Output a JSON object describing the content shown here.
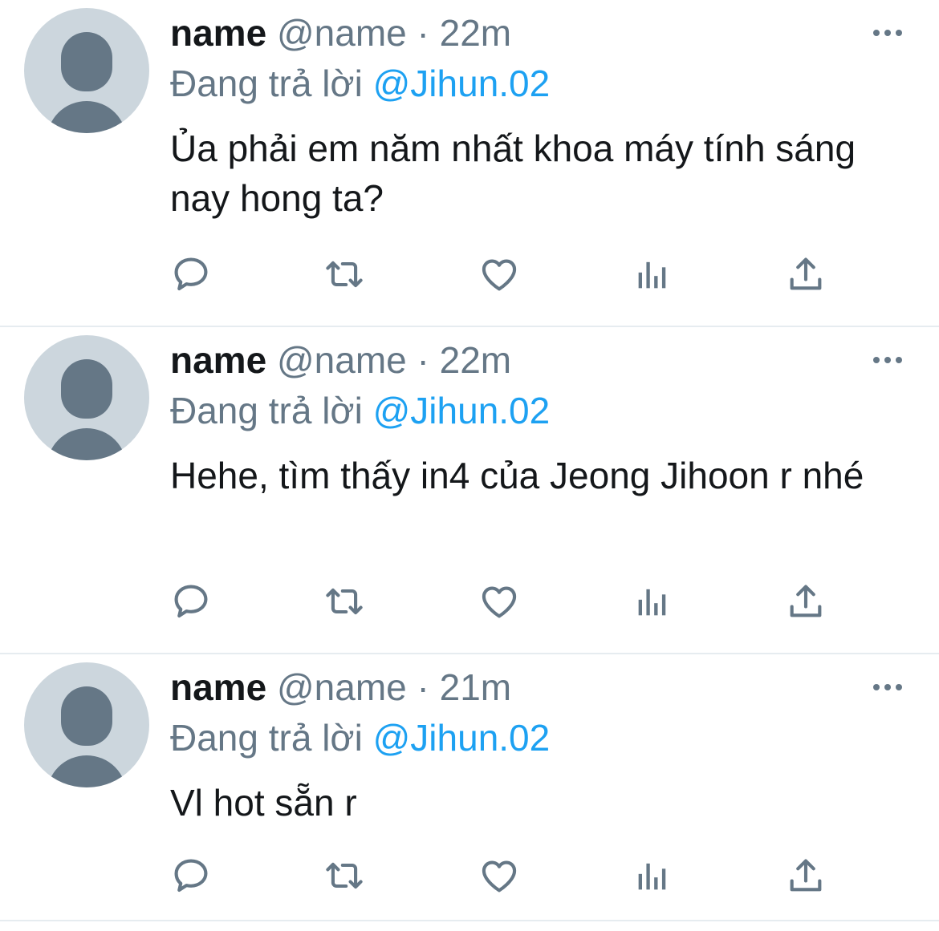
{
  "colors": {
    "text_primary": "#14171a",
    "text_secondary": "#657786",
    "mention": "#1da1f2",
    "avatar_bg": "#ccd6dd",
    "divider": "#e6ecf0"
  },
  "icons": [
    "reply-icon",
    "retweet-icon",
    "like-icon",
    "analytics-icon",
    "share-icon",
    "more-icon"
  ],
  "tweets": [
    {
      "display_name": "name",
      "handle": "@name",
      "separator": "·",
      "time": "22m",
      "replying_to_label": "Đang trả lời",
      "replying_to_handle": "@Jihun.02",
      "text": "Ủa phải em năm nhất khoa máy tính sáng nay hong ta?"
    },
    {
      "display_name": "name",
      "handle": "@name",
      "separator": "·",
      "time": "22m",
      "replying_to_label": "Đang trả lời",
      "replying_to_handle": "@Jihun.02",
      "text": "Hehe, tìm thấy in4 của Jeong Jihoon r nhé"
    },
    {
      "display_name": "name",
      "handle": "@name",
      "separator": "·",
      "time": "21m",
      "replying_to_label": "Đang trả lời",
      "replying_to_handle": "@Jihun.02",
      "text": "Vl hot sẵn r"
    }
  ]
}
